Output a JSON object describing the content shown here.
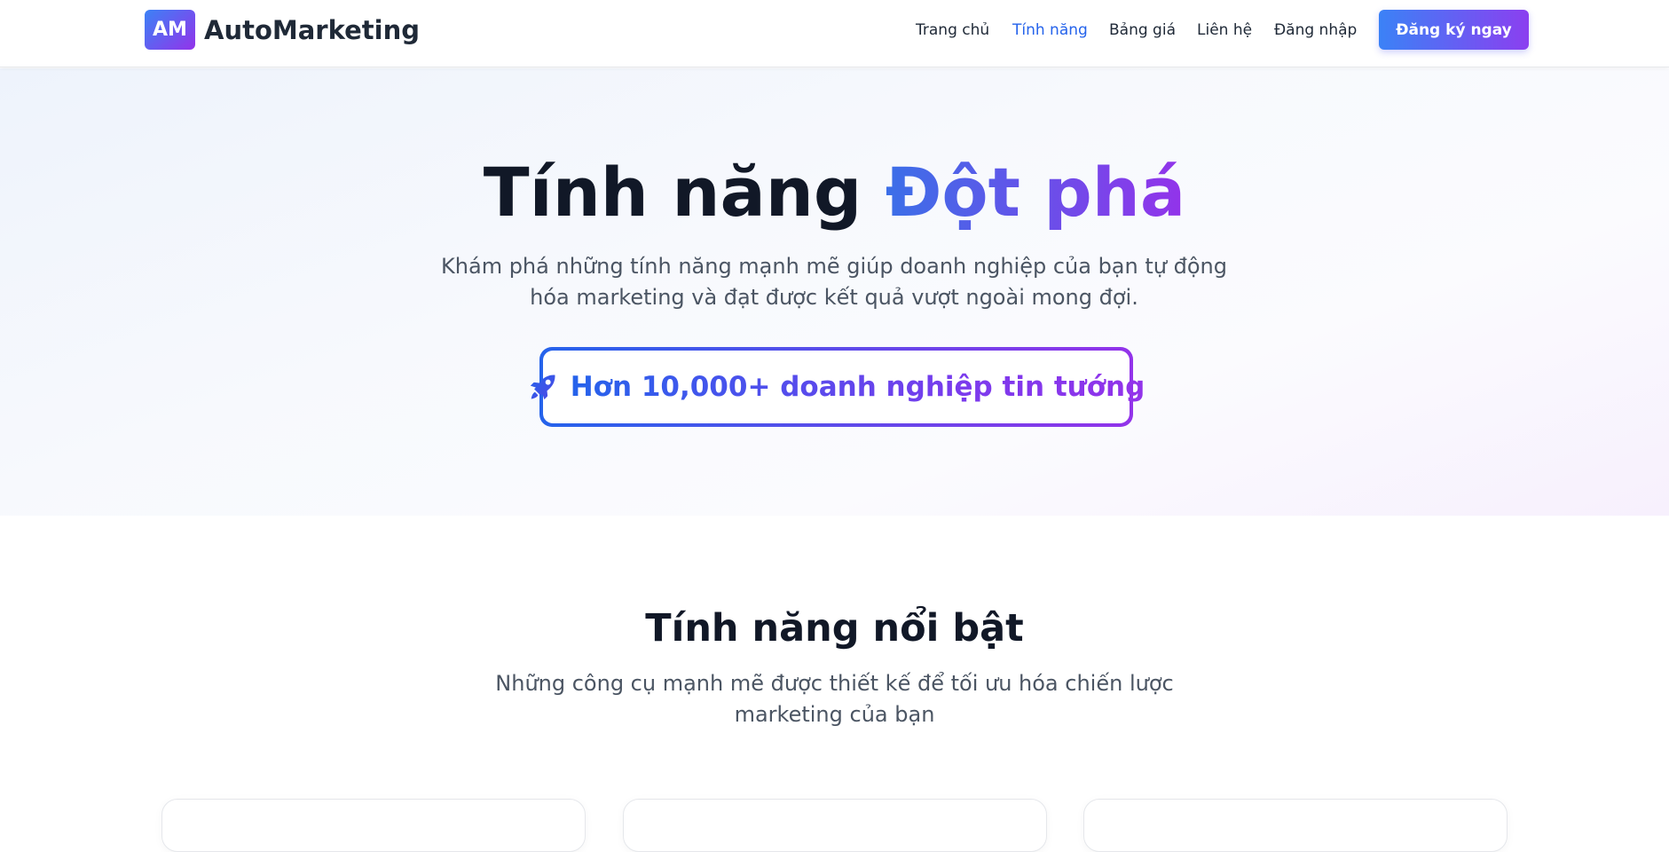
{
  "brand": {
    "badge": "AM",
    "name": "AutoMarketing",
    "gradient_start": "#3b82f6",
    "gradient_end": "#9333ea"
  },
  "nav": {
    "items": [
      {
        "label": "Trang chủ",
        "active": false
      },
      {
        "label": "Tính năng",
        "active": true
      },
      {
        "label": "Bảng giá",
        "active": false
      },
      {
        "label": "Liên hệ",
        "active": false
      },
      {
        "label": "Đăng nhập",
        "active": false
      }
    ],
    "cta_label": "Đăng ký ngay",
    "active_color": "#2563eb"
  },
  "hero": {
    "title_plain": "Tính năng ",
    "title_highlight": "Đột phá",
    "subtitle": "Khám phá những tính năng mạnh mẽ giúp doanh nghiệp của bạn tự động hóa marketing và đạt được kết quả vượt ngoài mong đợi.",
    "badge_icon": "rocket-icon",
    "badge_text": "Hơn 10,000+ doanh nghiệp tin tướng"
  },
  "features": {
    "title": "Tính năng nổi bật",
    "subtitle": "Những công cụ mạnh mẽ được thiết kế để tối ưu hóa chiến lược marketing của bạn"
  }
}
